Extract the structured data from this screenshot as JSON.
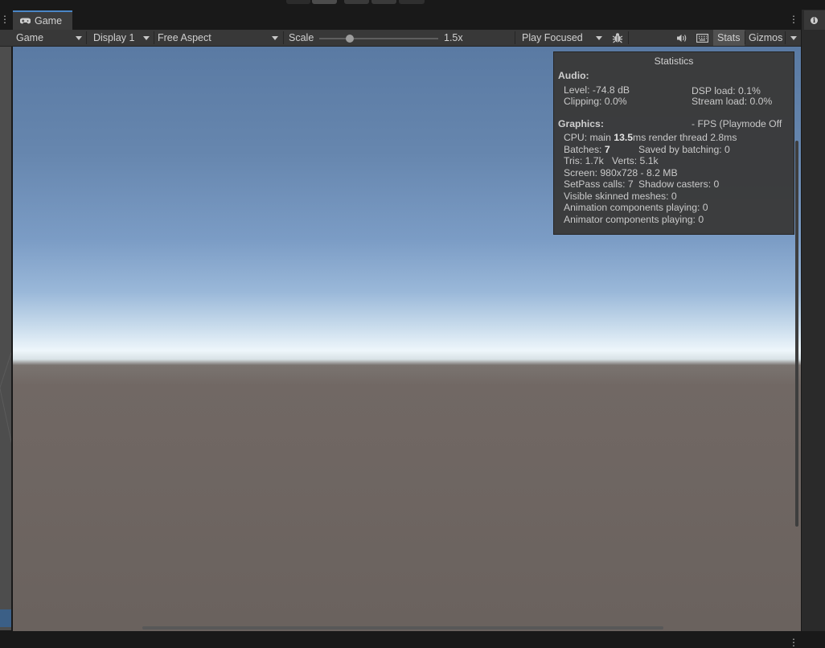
{
  "tab": {
    "title": "Game"
  },
  "toolbar": {
    "mode": "Game",
    "display": "Display 1",
    "aspect": "Free Aspect",
    "scale_label": "Scale",
    "scale_value": "1.5x",
    "play_mode": "Play Focused",
    "stats": "Stats",
    "gizmos": "Gizmos"
  },
  "stats_panel": {
    "title": "Statistics",
    "audio": {
      "heading": "Audio:",
      "level": "Level: -74.8 dB",
      "dsp_load": "DSP load: 0.1%",
      "clipping": "Clipping: 0.0%",
      "stream_load": "Stream load: 0.0%"
    },
    "graphics": {
      "heading": "Graphics:",
      "fps": "- FPS (Playmode Off",
      "cpu_prefix": "CPU: main ",
      "cpu_main": "13.5",
      "cpu_suffix": "ms  render thread 2.8ms",
      "batches_prefix": "Batches: ",
      "batches": "7",
      "saved_by_batching": "Saved by batching: 0",
      "tris": "Tris: 1.7k",
      "verts": "Verts: 5.1k",
      "screen": "Screen: 980x728 - 8.2 MB",
      "setpass": "SetPass calls: 7",
      "shadow_casters": "Shadow casters: 0",
      "skinned_meshes": "Visible skinned meshes: 0",
      "animation_components": "Animation components playing: 0",
      "animator_components": "Animator components playing: 0"
    }
  },
  "scale_slider": {
    "value_fraction": 0.26
  },
  "icons": [
    "gamepad-icon",
    "kebab-menu-icon",
    "dropdown-arrow-icon",
    "bug-icon",
    "audio-mute-icon",
    "keyboard-icon",
    "info-icon"
  ],
  "colors": {
    "tab_accent": "#4a86c7",
    "sky_top": "#5a7aa3",
    "horizon": "#eef6fb",
    "ground": "#6a625e"
  }
}
